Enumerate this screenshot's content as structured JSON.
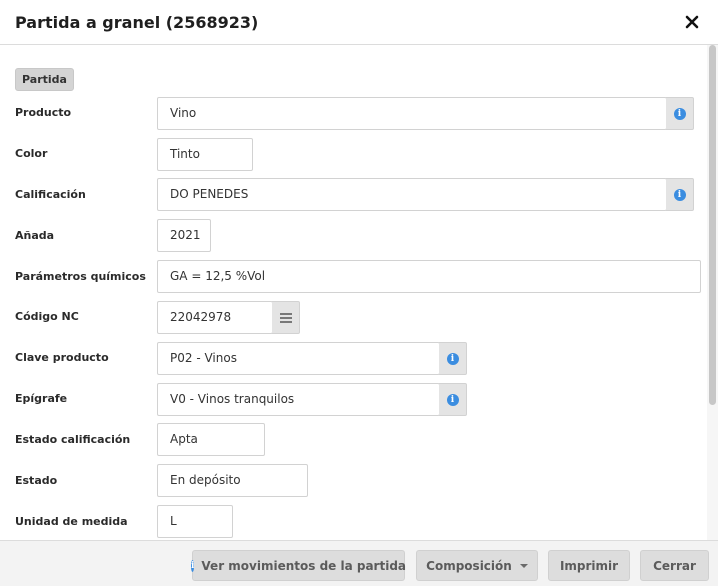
{
  "dialog": {
    "title": "Partida a granel (2568923)"
  },
  "section": {
    "label": "Partida"
  },
  "fields": {
    "producto": {
      "label": "Producto",
      "value": "Vino"
    },
    "color": {
      "label": "Color",
      "value": "Tinto"
    },
    "calificacion": {
      "label": "Calificación",
      "value": "DO PENEDES"
    },
    "anada": {
      "label": "Añada",
      "value": "2021"
    },
    "parametros": {
      "label": "Parámetros químicos",
      "value": "GA = 12,5 %Vol"
    },
    "codigo_nc": {
      "label": "Código NC",
      "value": "22042978"
    },
    "clave_producto": {
      "label": "Clave producto",
      "value": "P02 - Vinos"
    },
    "epigrafe": {
      "label": "Epígrafe",
      "value": "V0 - Vinos tranquilos"
    },
    "estado_calificacion": {
      "label": "Estado calificación",
      "value": "Apta"
    },
    "estado": {
      "label": "Estado",
      "value": "En depósito"
    },
    "unidad_medida": {
      "label": "Unidad de medida",
      "value": "L"
    }
  },
  "footer": {
    "movimientos_label": "Ver movimientos de la partida",
    "composicion_label": "Composición",
    "imprimir_label": "Imprimir",
    "cerrar_label": "Cerrar"
  },
  "icons": {
    "info": "info-icon",
    "close": "close-icon",
    "menu": "menu-icon",
    "caret": "caret-down-icon"
  },
  "colors": {
    "info_blue": "#3b8de0",
    "button_bg": "#dddddd",
    "section_tag_bg": "#d4d4d4"
  }
}
